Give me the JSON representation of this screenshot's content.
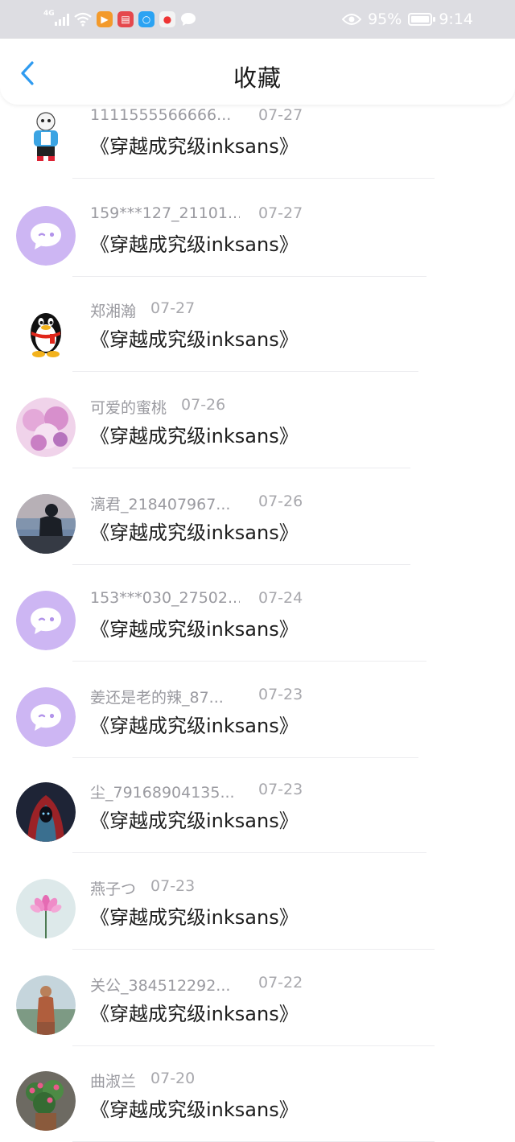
{
  "status_bar": {
    "network": "4G",
    "battery_percent": "95%",
    "time": "9:14"
  },
  "header": {
    "title": "收藏"
  },
  "items": [
    {
      "name": "1111555566666...",
      "date": "07-27",
      "work": "《穿越成究级inksans》",
      "avatar": "sans-character"
    },
    {
      "name": "159***127_21101...",
      "date": "07-27",
      "work": "《穿越成究级inksans》",
      "avatar": "default-purple"
    },
    {
      "name": "郑湘瀚",
      "date": "07-27",
      "work": "《穿越成究级inksans》",
      "avatar": "qq-penguin"
    },
    {
      "name": "可爱的蜜桃",
      "date": "07-26",
      "work": "《穿越成究级inksans》",
      "avatar": "anime-girl"
    },
    {
      "name": "漓君_218407967...",
      "date": "07-26",
      "work": "《穿越成究级inksans》",
      "avatar": "silhouette-person"
    },
    {
      "name": "153***030_27502...",
      "date": "07-24",
      "work": "《穿越成究级inksans》",
      "avatar": "default-purple"
    },
    {
      "name": "姜还是老的辣_87...",
      "date": "07-23",
      "work": "《穿越成究级inksans》",
      "avatar": "default-purple"
    },
    {
      "name": "尘_79168904135...",
      "date": "07-23",
      "work": "《穿越成究级inksans》",
      "avatar": "hooded-figure"
    },
    {
      "name": "燕子つ",
      "date": "07-23",
      "work": "《穿越成究级inksans》",
      "avatar": "lotus-flower"
    },
    {
      "name": "关公_384512292...",
      "date": "07-22",
      "work": "《穿越成究级inksans》",
      "avatar": "statue"
    },
    {
      "name": "曲淑兰",
      "date": "07-20",
      "work": "《穿越成究级inksans》",
      "avatar": "flower-pot"
    }
  ]
}
